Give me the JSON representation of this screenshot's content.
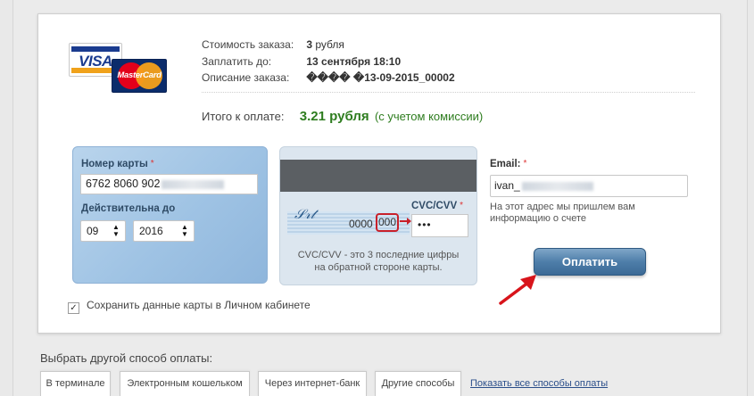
{
  "order": {
    "cost_label": "Стоимость заказа:",
    "cost_value": "3",
    "cost_unit": "рубля",
    "pay_until_label": "Заплатить до:",
    "pay_until_value": "13 сентября 18:10",
    "description_label": "Описание заказа:",
    "description_value": "���� �13-09-2015_00002"
  },
  "total": {
    "label": "Итого к оплате:",
    "amount": "3.21 рубля",
    "commission": "(с учетом комиссии)"
  },
  "logos": {
    "visa": "VISA",
    "mastercard": "MasterCard"
  },
  "card_front": {
    "number_label": "Номер карты",
    "number_value": "6762 8060 902",
    "valid_label": "Действительна до",
    "month_value": "09",
    "year_value": "2016",
    "required_mark": "*"
  },
  "card_back": {
    "digits": "0000",
    "cvc_example": "000",
    "cvc_label": "CVC/CVV",
    "cvc_value": "•••",
    "hint_line1": "CVC/CVV - это 3 последние цифры",
    "hint_line2": "на обратной стороне карты."
  },
  "email": {
    "label": "Email:",
    "value": "ivan_",
    "hint_line1": "На этот адрес мы пришлем вам",
    "hint_line2": "информацию о счете"
  },
  "pay_button": "Оплатить",
  "save_card": {
    "checked": true,
    "check_glyph": "✓",
    "label": "Сохранить данные карты в Личном кабинете"
  },
  "other_methods": {
    "title": "Выбрать другой способ оплаты:",
    "tabs": [
      {
        "label": "В терминале"
      },
      {
        "label": "Электронным кошельком"
      },
      {
        "label": "Через интернет-банк"
      },
      {
        "label": "Другие способы"
      }
    ],
    "show_all": "Показать все способы оплаты"
  },
  "colors": {
    "total_green": "#2e7d1f",
    "pay_button": "#4e7ea9",
    "required_red": "#d33",
    "cvc_highlight": "#c8202a",
    "arrow_red": "#d8141b"
  }
}
